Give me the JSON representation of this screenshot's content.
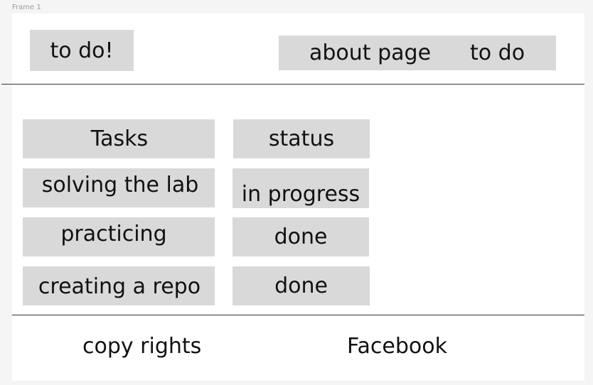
{
  "frame": {
    "label": "Frame 1"
  },
  "header": {
    "logo_label": "to do!",
    "nav": {
      "items": [
        "about page",
        "to do"
      ]
    }
  },
  "table": {
    "headers": [
      "Tasks",
      "status"
    ],
    "rows": [
      {
        "task": "solving the lab",
        "status": "in progress"
      },
      {
        "task": "practicing",
        "status": "done"
      },
      {
        "task": "creating a repo",
        "status": "done"
      }
    ]
  },
  "footer": {
    "copyright": "copy rights",
    "social_link": "Facebook"
  },
  "colors": {
    "box_fill": "#d9d9d9",
    "frame_bg": "#ffffff",
    "canvas_bg": "#f5f5f5",
    "rule": "#333333",
    "text": "#111111"
  }
}
